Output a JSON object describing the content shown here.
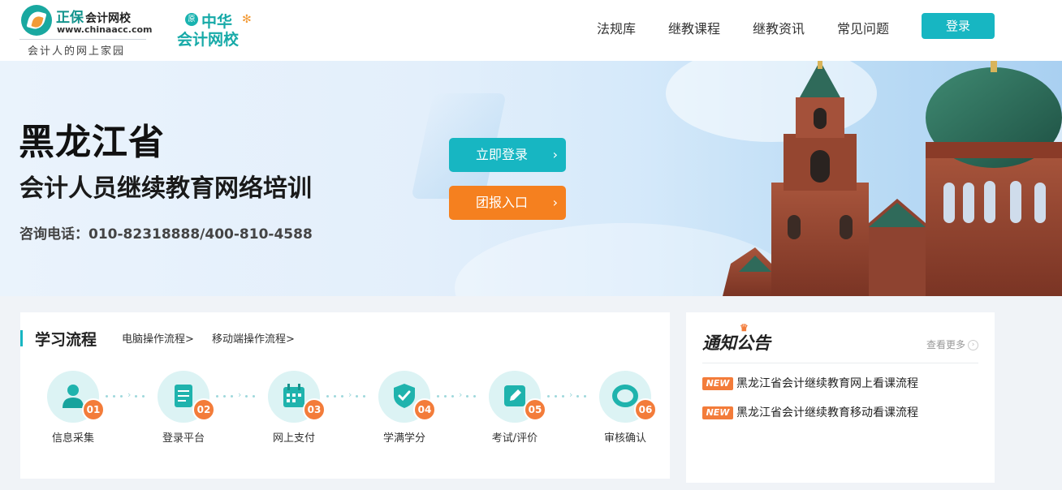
{
  "header": {
    "logo": {
      "brand": "正保",
      "brand_suffix": "会计网校",
      "url": "www.chinaacc.com",
      "slogan": "会计人的网上家园"
    },
    "sublogo": {
      "badge": "原",
      "line1": "中华",
      "line2": "会计网校"
    },
    "nav": [
      {
        "label": "法规库"
      },
      {
        "label": "继教课程"
      },
      {
        "label": "继教资讯"
      },
      {
        "label": "常见问题"
      }
    ],
    "login_label": "登录"
  },
  "banner": {
    "title": "黑龙江省",
    "subtitle": "会计人员继续教育网络培训",
    "tel": "咨询电话：010-82318888/400-810-4588",
    "primary_button": "立即登录",
    "secondary_button": "团报入口",
    "arrow": "›"
  },
  "flow": {
    "title": "学习流程",
    "links": [
      "电脑操作流程>",
      "移动端操作流程>"
    ],
    "steps": [
      {
        "num": "01",
        "label": "信息采集",
        "icon": "user-icon"
      },
      {
        "num": "02",
        "label": "登录平台",
        "icon": "document-icon"
      },
      {
        "num": "03",
        "label": "网上支付",
        "icon": "calendar-icon"
      },
      {
        "num": "04",
        "label": "学满学分",
        "icon": "shield-check-icon"
      },
      {
        "num": "05",
        "label": "考试/评价",
        "icon": "edit-icon"
      },
      {
        "num": "06",
        "label": "审核确认",
        "icon": "ring-icon"
      }
    ]
  },
  "notice": {
    "title": "通知公告",
    "more": "查看更多",
    "new_badge": "NEW",
    "items": [
      "黑龙江省会计继续教育网上看课流程",
      "黑龙江省会计继续教育移动看课流程"
    ]
  },
  "colors": {
    "accent": "#17b6c2",
    "orange": "#f5801f",
    "badge": "#f37c3a"
  }
}
